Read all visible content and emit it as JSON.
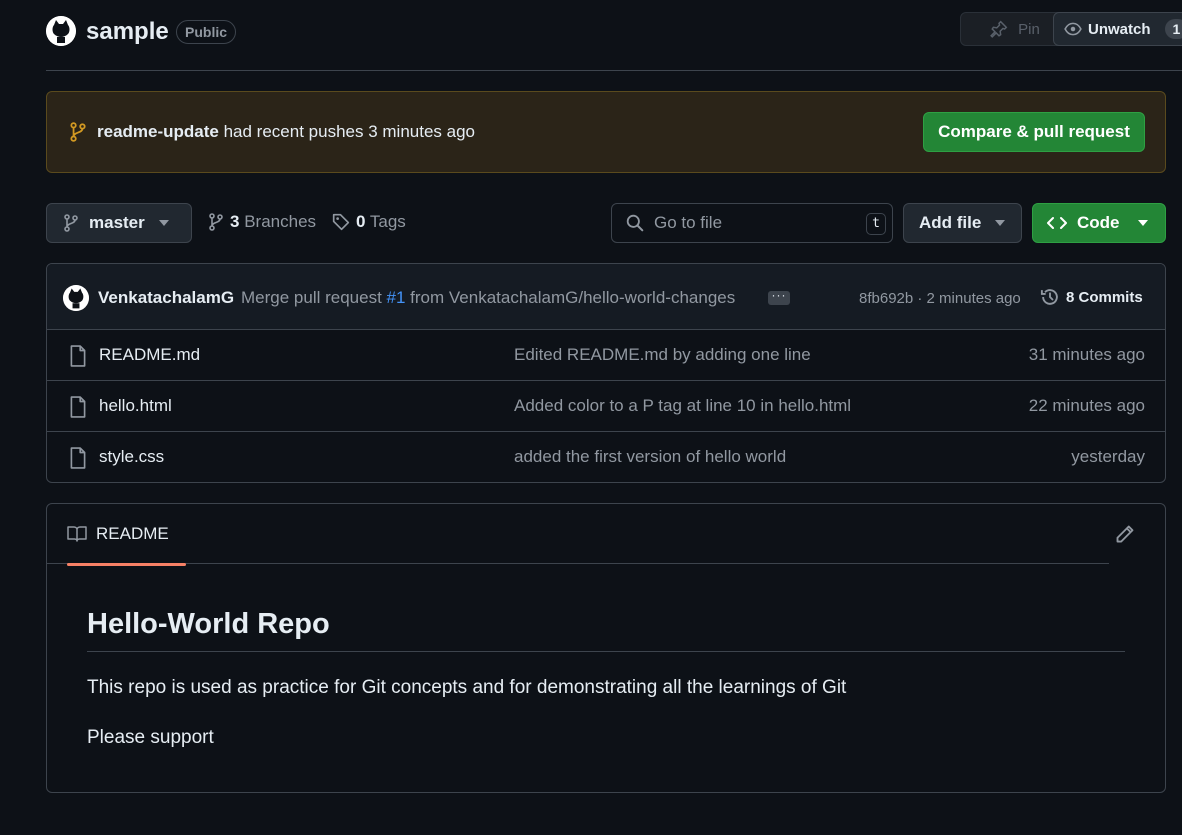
{
  "repo": {
    "name": "sample",
    "visibility": "Public",
    "pin_label": "Pin",
    "unwatch_label": "Unwatch",
    "watch_count": "1"
  },
  "banner": {
    "branch": "readme-update",
    "message": " had recent pushes 3 minutes ago",
    "compare_label": "Compare & pull request"
  },
  "toolbar": {
    "branch": "master",
    "branches_count": "3",
    "branches_label": "Branches",
    "tags_count": "0",
    "tags_label": "Tags",
    "goto_placeholder": "Go to file",
    "goto_shortcut": "t",
    "add_file_label": "Add file",
    "code_label": "Code"
  },
  "commit": {
    "author": "VenkatachalamG",
    "message_prefix": "Merge pull request ",
    "pr_number": "#1",
    "message_suffix": " from VenkatachalamG/hello-world-changes",
    "sha_time": "8fb692b · 2 minutes ago",
    "commits_label": "8 Commits"
  },
  "files": [
    {
      "name": "README.md",
      "commit": "Edited README.md by adding one line",
      "time": "31 minutes ago"
    },
    {
      "name": "hello.html",
      "commit": "Added color to a P tag at line 10 in hello.html",
      "time": "22 minutes ago"
    },
    {
      "name": "style.css",
      "commit": "added the first version of hello world",
      "time": "yesterday"
    }
  ],
  "readme": {
    "tab_label": "README",
    "title": "Hello-World Repo",
    "paragraphs": [
      "This repo is used as practice for Git concepts and for demonstrating all the learnings of Git",
      "Please support"
    ]
  },
  "colors": {
    "background": "#0d1117",
    "accent_green": "#238636",
    "link_blue": "#4493f8",
    "tab_underline": "#f78166",
    "banner_bg": "#2b2418"
  },
  "icons": [
    "github-octocat-icon",
    "pin-icon",
    "eye-icon",
    "git-branch-icon",
    "tag-icon",
    "search-icon",
    "caret-down-icon",
    "code-icon",
    "history-icon",
    "file-icon",
    "book-icon",
    "pencil-icon"
  ]
}
